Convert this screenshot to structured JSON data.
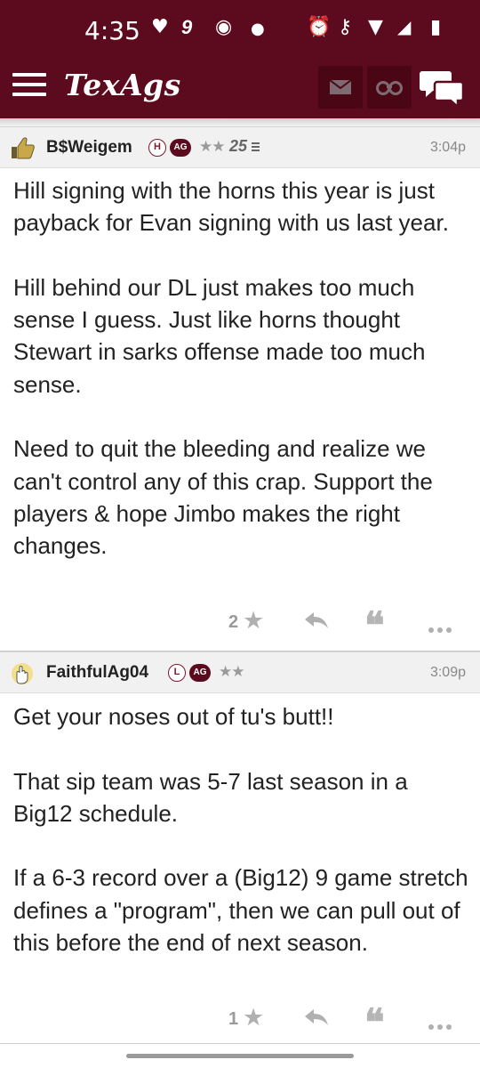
{
  "status_bar": {
    "time": "4:35",
    "icons": [
      "heart-icon",
      "nine-icon",
      "chrome-icon",
      "dot-icon",
      "alarm-icon",
      "key-icon",
      "wifi-icon",
      "no-signal-icon",
      "battery-charging-icon"
    ]
  },
  "app_bar": {
    "logo": "TexAgs",
    "buttons": [
      "menu-icon",
      "mail-icon",
      "binoculars-icon",
      "chat-icon"
    ]
  },
  "colors": {
    "brand": "#5c0a1e",
    "header_bg": "#f1f1f1",
    "muted": "#9a9a9a"
  },
  "posts": [
    {
      "username": "B$Weigem",
      "badges": [
        "H",
        "AG"
      ],
      "stars": "★★",
      "rank": "25",
      "time": "3:04p",
      "body": "Hill signing with the horns this year is just payback for Evan signing with us last year.\n\nHill behind our DL just makes too much sense I guess. Just like horns thought Stewart in sarks offense made too much sense.\n\nNeed to quit the bleeding and realize we can't control any of this crap. Support the players & hope Jimbo makes the right changes.",
      "likes": "2",
      "avatar": "thumbs-up-icon"
    },
    {
      "username": "FaithfulAg04",
      "badges": [
        "L",
        "AG"
      ],
      "stars": "★★",
      "time": "3:09p",
      "body": "Get your noses out of tu's butt!!\n\nThat sip team was 5-7 last season in a Big12 schedule.\n\nIf a 6-3 record over a (Big12) 9 game stretch defines a \"program\", then we can pull out of this before the end of next season.",
      "likes": "1",
      "avatar": "gig-em-hand-icon"
    }
  ]
}
